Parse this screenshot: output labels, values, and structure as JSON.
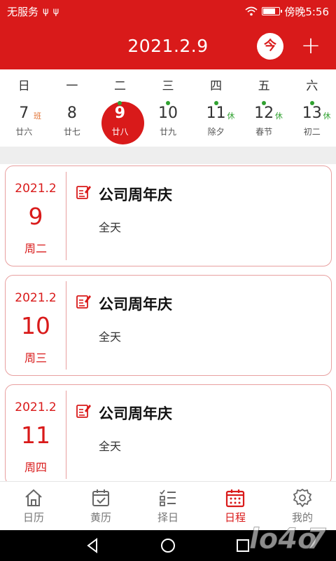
{
  "statusbar": {
    "carrier": "无服务",
    "usb1": "ψ",
    "usb2": "ψ",
    "time_label": "傍晚5:56"
  },
  "header": {
    "title": "2021.2.9",
    "today_label": "今",
    "add_label": "+"
  },
  "weekdays": [
    "日",
    "一",
    "二",
    "三",
    "四",
    "五",
    "六"
  ],
  "days": [
    {
      "num": "7",
      "lunar": "廿六",
      "tag": "班",
      "tag_type": "ban",
      "dot": false
    },
    {
      "num": "8",
      "lunar": "廿七",
      "tag": "",
      "tag_type": "",
      "dot": false
    },
    {
      "num": "9",
      "lunar": "廿八",
      "tag": "",
      "tag_type": "",
      "dot": true,
      "selected": true
    },
    {
      "num": "10",
      "lunar": "廿九",
      "tag": "",
      "tag_type": "",
      "dot": true
    },
    {
      "num": "11",
      "lunar": "除夕",
      "tag": "休",
      "tag_type": "xiu",
      "dot": true
    },
    {
      "num": "12",
      "lunar": "春节",
      "tag": "休",
      "tag_type": "xiu",
      "dot": true
    },
    {
      "num": "13",
      "lunar": "初二",
      "tag": "休",
      "tag_type": "xiu",
      "dot": true
    }
  ],
  "events": [
    {
      "ym": "2021.2",
      "day": "9",
      "weekday": "周二",
      "title": "公司周年庆",
      "time": "全天"
    },
    {
      "ym": "2021.2",
      "day": "10",
      "weekday": "周三",
      "title": "公司周年庆",
      "time": "全天"
    },
    {
      "ym": "2021.2",
      "day": "11",
      "weekday": "周四",
      "title": "公司周年庆",
      "time": "全天"
    }
  ],
  "tabs": [
    {
      "label": "日历",
      "icon": "home-icon"
    },
    {
      "label": "黄历",
      "icon": "calendar-check-icon"
    },
    {
      "label": "择日",
      "icon": "list-icon"
    },
    {
      "label": "日程",
      "icon": "schedule-icon",
      "active": true
    },
    {
      "label": "我的",
      "icon": "gear-icon"
    }
  ],
  "colors": {
    "accent": "#d91a1a",
    "holiday": "#2fa12f",
    "workday": "#e07030"
  }
}
